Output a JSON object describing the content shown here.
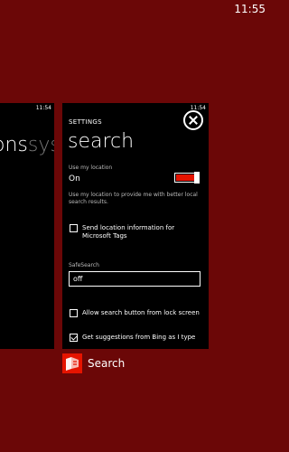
{
  "status_bar": {
    "time": "11:55"
  },
  "background_card": {
    "time": "11:54",
    "title_visible": "ons",
    "title_dim": "sys"
  },
  "settings_card": {
    "time": "11:54",
    "section_label": "SETTINGS",
    "heading": "search",
    "location": {
      "label": "Use my location",
      "value": "On",
      "description": "Use my location to provide me with better local search results.",
      "toggle_on": true
    },
    "send_location": {
      "label": "Send location information for Microsoft Tags",
      "checked": false
    },
    "safesearch": {
      "label": "SafeSearch",
      "value": "off"
    },
    "lock_screen": {
      "label": "Allow search button from lock screen",
      "checked": false
    },
    "suggestions": {
      "label": "Get suggestions from Bing as I type",
      "checked": true
    }
  },
  "app": {
    "label": "Search",
    "icon": "bing-search-icon",
    "accent_color": "#e51400"
  },
  "colors": {
    "background": "#6b0707",
    "card": "#000000",
    "accent": "#e51400"
  }
}
